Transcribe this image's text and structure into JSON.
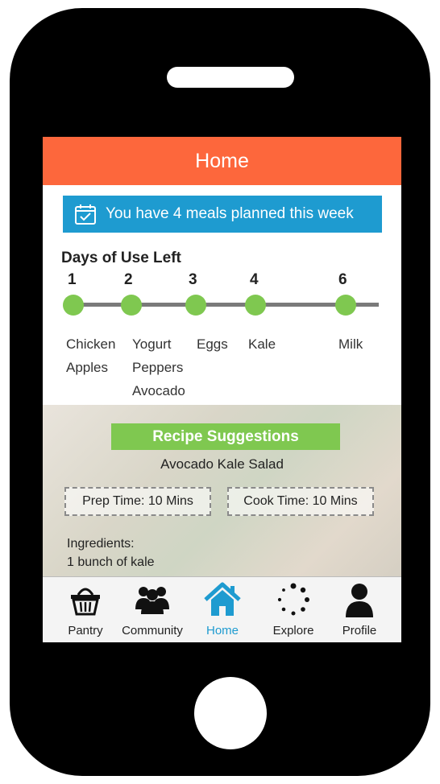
{
  "header": {
    "title": "Home"
  },
  "banner": {
    "text": "You have 4 meals planned this week",
    "icon": "calendar-check-icon"
  },
  "days": {
    "title": "Days of Use Left",
    "markers": [
      {
        "day": "1",
        "items": [
          "Chicken",
          "Apples"
        ]
      },
      {
        "day": "2",
        "items": [
          "Yogurt",
          "Peppers",
          "Avocado"
        ]
      },
      {
        "day": "3",
        "items": [
          "Eggs"
        ]
      },
      {
        "day": "4",
        "items": [
          "Kale"
        ]
      },
      {
        "day": "6",
        "items": [
          "Milk"
        ]
      }
    ]
  },
  "recipe": {
    "section_title": "Recipe Suggestions",
    "name": "Avocado Kale Salad",
    "prep": "Prep Time: 10 Mins",
    "cook": "Cook Time: 10 Mins",
    "ingredients_title": "Ingredients:",
    "ingredient_1": "1 bunch of kale"
  },
  "nav": {
    "items": [
      {
        "label": "Pantry",
        "icon": "basket-icon"
      },
      {
        "label": "Community",
        "icon": "people-icon"
      },
      {
        "label": "Home",
        "icon": "house-icon",
        "active": true
      },
      {
        "label": "Explore",
        "icon": "dots-circle-icon"
      },
      {
        "label": "Profile",
        "icon": "person-icon"
      }
    ]
  },
  "colors": {
    "header": "#fd673c",
    "banner": "#1e9bd0",
    "accent_green": "#7fc850",
    "active_nav": "#1e9bd0"
  }
}
